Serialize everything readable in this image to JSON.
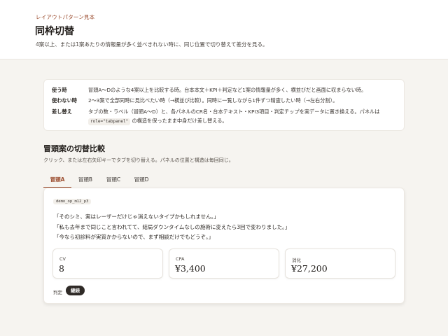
{
  "header": {
    "eyebrow": "レイアウトパターン見本",
    "title": "同枠切替",
    "description": "4案以上、または1案あたりの情報量が多く並べきれない時に、同じ位置で切り替えて差分を見る。"
  },
  "rules": [
    {
      "label": "使う時",
      "text": "冒頭A〜Dのような4案以上を比較する時。台本本文＋KPI＋判定など1案の情報量が多く、横並びだと画面に収まらない時。"
    },
    {
      "label": "使わない時",
      "text": "2〜3案で全部同時に見比べたい時（→横並び比較）。同時に一覧しながら1件ずつ精査したい時（→左右分割）。"
    },
    {
      "label": "差し替え",
      "text_line1": "タブの数・ラベル（冒頭A〜D）と、各パネルのCR名・台本テキスト・KPI3項目・判定チップを実データに置き換える。パネルは",
      "code": "role=\"tabpanel\"",
      "text_line2": "の構造を保ったまま中身だけ差し替える。"
    }
  ],
  "section": {
    "title": "冒頭案の切替比較",
    "description": "クリック、または左右矢印キーでタブを切り替える。パネルの位置と構造は毎回同じ。"
  },
  "tabs": [
    {
      "label": "冒頭A",
      "active": true
    },
    {
      "label": "冒頭B",
      "active": false
    },
    {
      "label": "冒頭C",
      "active": false
    },
    {
      "label": "冒頭D",
      "active": false
    }
  ],
  "panel": {
    "cr_name": "demo_op_m12_p3",
    "script_lines": [
      "「そのシミ、実はレーザーだけじゃ消えないタイプかもしれません。」",
      "「私も去年まで同じこと言われてて、結局ダウンタイムなしの施術に変えたら3回で変わりました。」",
      "「今なら初診料が実質かからないので、まず相談だけでもどうぞ。」"
    ],
    "kpis": [
      {
        "label": "CV",
        "value": "8"
      },
      {
        "label": "CPA",
        "value": "¥3,400"
      },
      {
        "label": "消化",
        "value": "¥27,200"
      }
    ],
    "verdict_label": "判定",
    "verdict": "継続"
  },
  "colors": {
    "accent": "#9a4a2c",
    "background": "#f6f4f0",
    "badge": "#2f2a27"
  }
}
